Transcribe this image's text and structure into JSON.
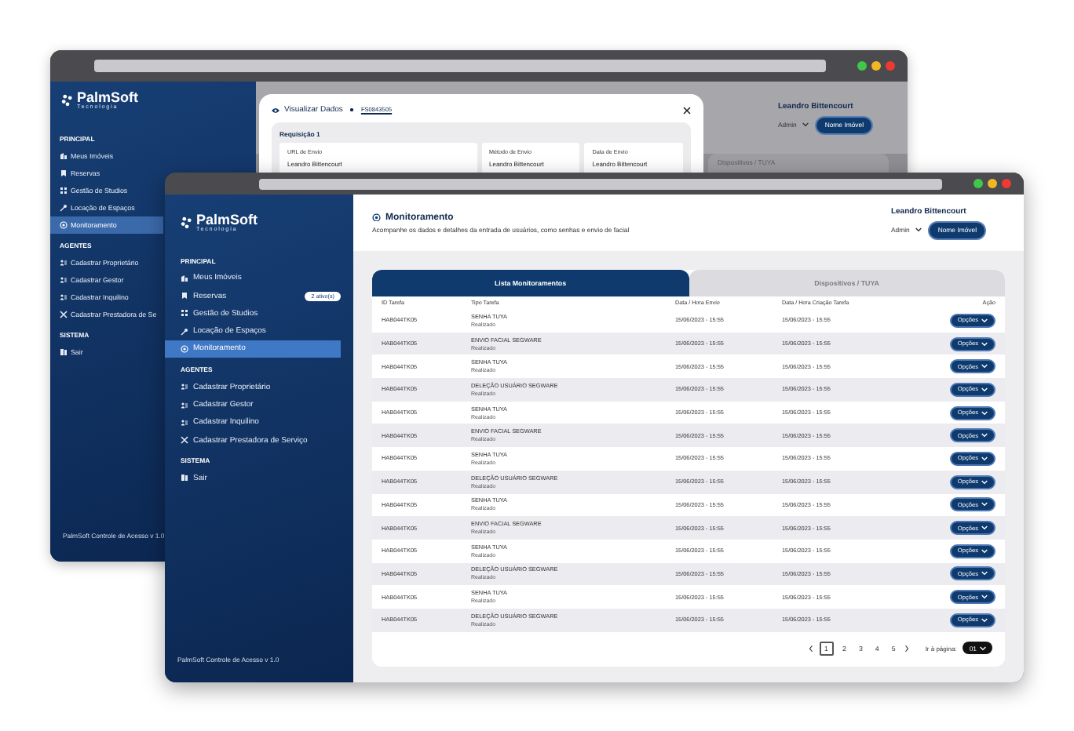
{
  "back_window": {
    "sidebar": {
      "logo": "PalmSoft",
      "logo_sub": "Tecnologia",
      "sections": [
        {
          "title": "PRINCIPAL",
          "items": [
            {
              "label": "Meus Imóveis",
              "selected": false
            },
            {
              "label": "Reservas",
              "selected": false
            },
            {
              "label": "Gestão de Studios",
              "selected": false
            },
            {
              "label": "Locação de Espaços",
              "selected": false
            },
            {
              "label": "Monitoramento",
              "selected": true
            }
          ]
        },
        {
          "title": "AGENTES",
          "items": [
            {
              "label": "Cadastrar Proprietário",
              "selected": false
            },
            {
              "label": "Cadastrar Gestor",
              "selected": false
            },
            {
              "label": "Cadastrar Inquilino",
              "selected": false
            },
            {
              "label": "Cadastrar Prestadora de Se",
              "selected": false
            }
          ]
        },
        {
          "title": "SISTEMA",
          "items": [
            {
              "label": "Sair",
              "selected": false
            }
          ]
        }
      ],
      "footer": "PalmSoft Controle de Acesso v 1.0"
    },
    "user": {
      "name": "Leandro Bittencourt",
      "role": "Admin",
      "property_button": "Nome Imóvel"
    },
    "tab": "Dispositivos / TUYA",
    "modal": {
      "title": "Visualizar Dados",
      "code": "FS0843505",
      "section": "Requisição 1",
      "fields": [
        {
          "label": "URL de Envio",
          "value": "Leandro Bittencourt"
        },
        {
          "label": "Método de Envio",
          "value": "Leandro Bittencourt"
        },
        {
          "label": "Data de Envio",
          "value": "Leandro Bittencourt"
        }
      ]
    }
  },
  "front_window": {
    "sidebar": {
      "logo": "PalmSoft",
      "logo_sub": "Tecnologia",
      "sections": [
        {
          "title": "PRINCIPAL",
          "items": [
            {
              "label": "Meus Imóveis",
              "selected": false
            },
            {
              "label": "Reservas",
              "selected": false,
              "badge": "2 ativo(s)"
            },
            {
              "label": "Gestão de Studios",
              "selected": false
            },
            {
              "label": "Locação de Espaços",
              "selected": false
            },
            {
              "label": "Monitoramento",
              "selected": true
            }
          ]
        },
        {
          "title": "AGENTES",
          "items": [
            {
              "label": "Cadastrar Proprietário",
              "selected": false
            },
            {
              "label": "Cadastrar Gestor",
              "selected": false
            },
            {
              "label": "Cadastrar Inquilino",
              "selected": false
            },
            {
              "label": "Cadastrar Prestadora de Serviço",
              "selected": false
            }
          ]
        },
        {
          "title": "SISTEMA",
          "items": [
            {
              "label": "Sair",
              "selected": false
            }
          ]
        }
      ],
      "footer": "PalmSoft Controle de Acesso v 1.0"
    },
    "header": {
      "title": "Monitoramento",
      "subtitle": "Acompanhe os dados e detalhes da entrada de usuários, como senhas e envio de facial"
    },
    "user": {
      "name": "Leandro Bittencourt",
      "role": "Admin",
      "property_button": "Nome Imóvel"
    },
    "tabs": [
      {
        "label": "Lista Monitoramentos",
        "selected": true
      },
      {
        "label": "Dispositivos / TUYA",
        "selected": false
      }
    ],
    "columns": [
      "ID Tarefa",
      "Tipo Tarefa",
      "Data / Hora Envio",
      "Data / Hora Criação Tarefa",
      "Ação"
    ],
    "rows": [
      {
        "id": "HAB044TK05",
        "type": "SENHA TUYA",
        "status": "Realizado",
        "sent": "15/06/2023 - 15:55",
        "created": "15/06/2023 - 15:55",
        "action": "Opções"
      },
      {
        "id": "HAB044TK05",
        "type": "ENVIO FACIAL SEGWARE",
        "status": "Realizado",
        "sent": "15/06/2023 - 15:55",
        "created": "15/06/2023 - 15:55",
        "action": "Opções"
      },
      {
        "id": "HAB044TK05",
        "type": "SENHA TUYA",
        "status": "Realizado",
        "sent": "15/06/2023 - 15:55",
        "created": "15/06/2023 - 15:55",
        "action": "Opções"
      },
      {
        "id": "HAB044TK05",
        "type": "DELEÇÃO USUÁRIO SEGWARE",
        "status": "Realizado",
        "sent": "15/06/2023 - 15:55",
        "created": "15/06/2023 - 15:55",
        "action": "Opções"
      },
      {
        "id": "HAB044TK05",
        "type": "SENHA TUYA",
        "status": "Realizado",
        "sent": "15/06/2023 - 15:55",
        "created": "15/06/2023 - 15:55",
        "action": "Opções"
      },
      {
        "id": "HAB044TK05",
        "type": "ENVIO FACIAL SEGWARE",
        "status": "Realizado",
        "sent": "15/06/2023 - 15:55",
        "created": "15/06/2023 - 15:55",
        "action": "Opções"
      },
      {
        "id": "HAB044TK05",
        "type": "SENHA TUYA",
        "status": "Realizado",
        "sent": "15/06/2023 - 15:55",
        "created": "15/06/2023 - 15:55",
        "action": "Opções"
      },
      {
        "id": "HAB044TK05",
        "type": "DELEÇÃO USUÁRIO SEGWARE",
        "status": "Realizado",
        "sent": "15/06/2023 - 15:55",
        "created": "15/06/2023 - 15:55",
        "action": "Opções"
      },
      {
        "id": "HAB044TK05",
        "type": "SENHA TUYA",
        "status": "Realizado",
        "sent": "15/06/2023 - 15:55",
        "created": "15/06/2023 - 15:55",
        "action": "Opções"
      },
      {
        "id": "HAB044TK05",
        "type": "ENVIO FACIAL SEGWARE",
        "status": "Realizado",
        "sent": "15/06/2023 - 15:55",
        "created": "15/06/2023 - 15:55",
        "action": "Opções"
      },
      {
        "id": "HAB044TK05",
        "type": "SENHA TUYA",
        "status": "Realizado",
        "sent": "15/06/2023 - 15:55",
        "created": "15/06/2023 - 15:55",
        "action": "Opções"
      },
      {
        "id": "HAB044TK05",
        "type": "DELEÇÃO USUÁRIO SEGWARE",
        "status": "Realizado",
        "sent": "15/06/2023 - 15:55",
        "created": "15/06/2023 - 15:55",
        "action": "Opções"
      },
      {
        "id": "HAB044TK05",
        "type": "SENHA TUYA",
        "status": "Realizado",
        "sent": "15/06/2023 - 15:55",
        "created": "15/06/2023 - 15:55",
        "action": "Opções"
      },
      {
        "id": "HAB044TK05",
        "type": "DELEÇÃO USUÁRIO SEGWARE",
        "status": "Realizado",
        "sent": "15/06/2023 - 15:55",
        "created": "15/06/2023 - 15:55",
        "action": "Opções"
      }
    ],
    "pagination": {
      "pages": [
        {
          "label": "1",
          "selected": true
        },
        {
          "label": "2",
          "selected": false
        },
        {
          "label": "3",
          "selected": false
        },
        {
          "label": "4",
          "selected": false
        },
        {
          "label": "5",
          "selected": false
        }
      ],
      "goto_label": "Ir à página:",
      "page_select": "01"
    }
  }
}
